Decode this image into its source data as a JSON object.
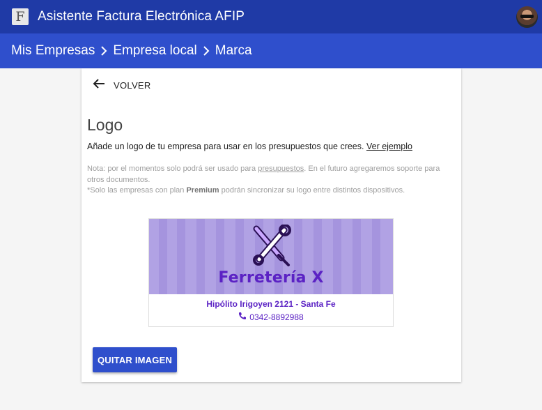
{
  "appbar": {
    "logo_letter": "F",
    "title": "Asistente Factura Electrónica AFIP"
  },
  "breadcrumb": {
    "items": [
      "Mis Empresas",
      "Empresa local",
      "Marca"
    ]
  },
  "card": {
    "back_label": "VOLVER",
    "title": "Logo",
    "description": "Añade un logo de tu empresa para usar en los presupuestos que crees.",
    "example_link": "Ver ejemplo",
    "note_prefix": "Nota: por el momentos solo podrá ser usado para ",
    "note_link": "presupuestos",
    "note_suffix": ". En el futuro agregaremos soporte para otros documentos.",
    "plan_prefix": "*Solo las empresas con plan ",
    "plan_name": "Premium",
    "plan_suffix": " podrán sincronizar su logo entre distintos dispositivos.",
    "remove_button": "QUITAR IMAGEN"
  },
  "logo_image": {
    "brand": "Ferretería X",
    "address": "Hipólito Irigoyen 2121 - Santa Fe",
    "phone": "0342-8892988",
    "banner_color": "#b1a2e4",
    "text_color": "#5b22c4",
    "icon": "tools-icon"
  },
  "colors": {
    "appbar": "#1f3aa6",
    "breadcrumb_bar": "#2f4fcc",
    "button": "#2f4fcc"
  }
}
